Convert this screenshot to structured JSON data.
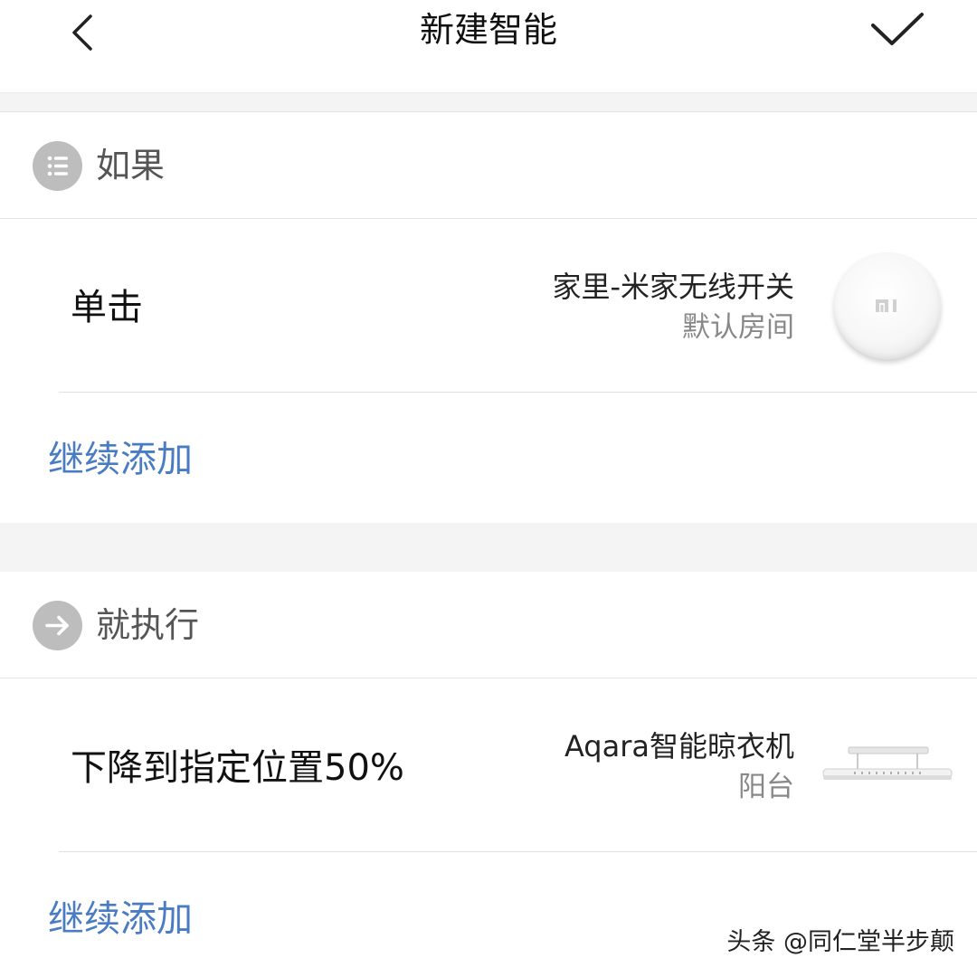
{
  "header": {
    "title": "新建智能",
    "back_icon": "chevron-left-icon",
    "confirm_icon": "checkmark-icon"
  },
  "condition_section": {
    "title": "如果",
    "icon": "list-icon",
    "rules": [
      {
        "action": "单击",
        "device_name": "家里-米家无线开关",
        "device_room": "默认房间",
        "device_image": "wireless-switch-icon",
        "device_logo_text": "mi"
      }
    ],
    "add_more_label": "继续添加"
  },
  "action_section": {
    "title": "就执行",
    "icon": "arrow-right-icon",
    "rules": [
      {
        "action": "下降到指定位置50%",
        "device_name": "Aqara智能晾衣机",
        "device_room": "阳台",
        "device_image": "clothes-dryer-icon"
      }
    ],
    "add_more_label": "继续添加"
  },
  "watermark": "头条 @同仁堂半步颠",
  "colors": {
    "link": "#4a7cc4",
    "section_icon_bg": "#bdbdbd",
    "divider": "#e0e0e0",
    "gap_bg": "#f4f4f4"
  }
}
